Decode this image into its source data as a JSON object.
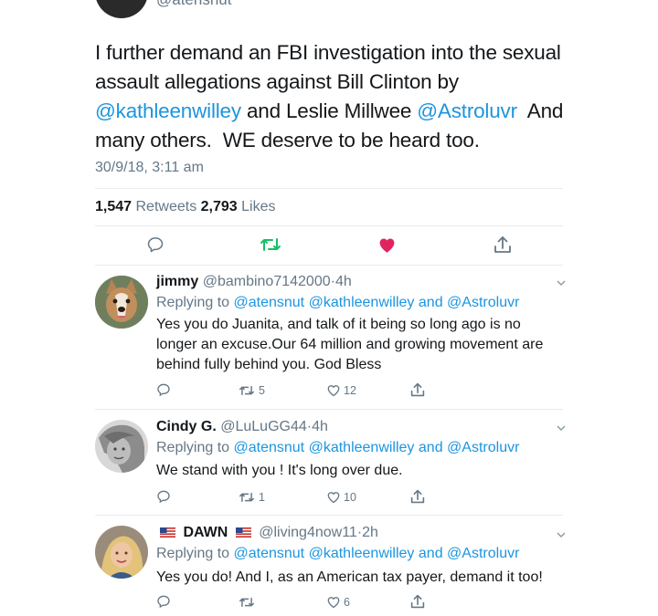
{
  "main_tweet": {
    "handle_partial": "@atensnut",
    "text_lines": [
      [
        "I further demand an FBI investigation into the sexual"
      ],
      [
        "assault allegations against Bill Clinton by"
      ],
      [
        "@kathleenwilley",
        " and Leslie Millwee ",
        "@Astroluvr",
        "  And"
      ],
      [
        "many others.  WE deserve to be heard too."
      ]
    ],
    "timestamp": "30/9/18, 3:11 am",
    "retweets_count": "1,547",
    "retweets_label": "Retweets",
    "likes_count": "2,793",
    "likes_label": "Likes",
    "icons": [
      "reply-icon",
      "retweet-icon",
      "like-icon",
      "share-icon"
    ],
    "retweet_color": "#17bf63",
    "like_color": "#e0245e"
  },
  "replies": [
    {
      "name": "jimmy",
      "handle": "@bambino7142000",
      "time": "4h",
      "replying_label": "Replying to",
      "replying_to": [
        "@atensnut",
        "@kathleenwilley",
        "and",
        "@Astroluvr"
      ],
      "body": "Yes you do Juanita, and talk of it being so long ago is no longer an excuse.Our 64 million and growing movement are behind fully behind you. God Bless",
      "retweets": "5",
      "likes": "12"
    },
    {
      "name": "Cindy G.",
      "handle": "@LuLuGG44",
      "time": "4h",
      "replying_label": "Replying to",
      "replying_to": [
        "@atensnut",
        "@kathleenwilley",
        "and",
        "@Astroluvr"
      ],
      "body": "We stand with you ! It's long over due.",
      "retweets": "1",
      "likes": "10"
    },
    {
      "name": "DAWN",
      "handle": "@living4now11",
      "time": "2h",
      "replying_label": "Replying to",
      "replying_to": [
        "@atensnut",
        "@kathleenwilley",
        "and",
        "@Astroluvr"
      ],
      "body": "Yes you do! And I, as an American tax payer, demand it too!",
      "retweets": "",
      "likes": "6"
    }
  ],
  "colors": {
    "accent": "#1b95e0",
    "muted": "#657786",
    "divider": "#e6ecf0"
  }
}
